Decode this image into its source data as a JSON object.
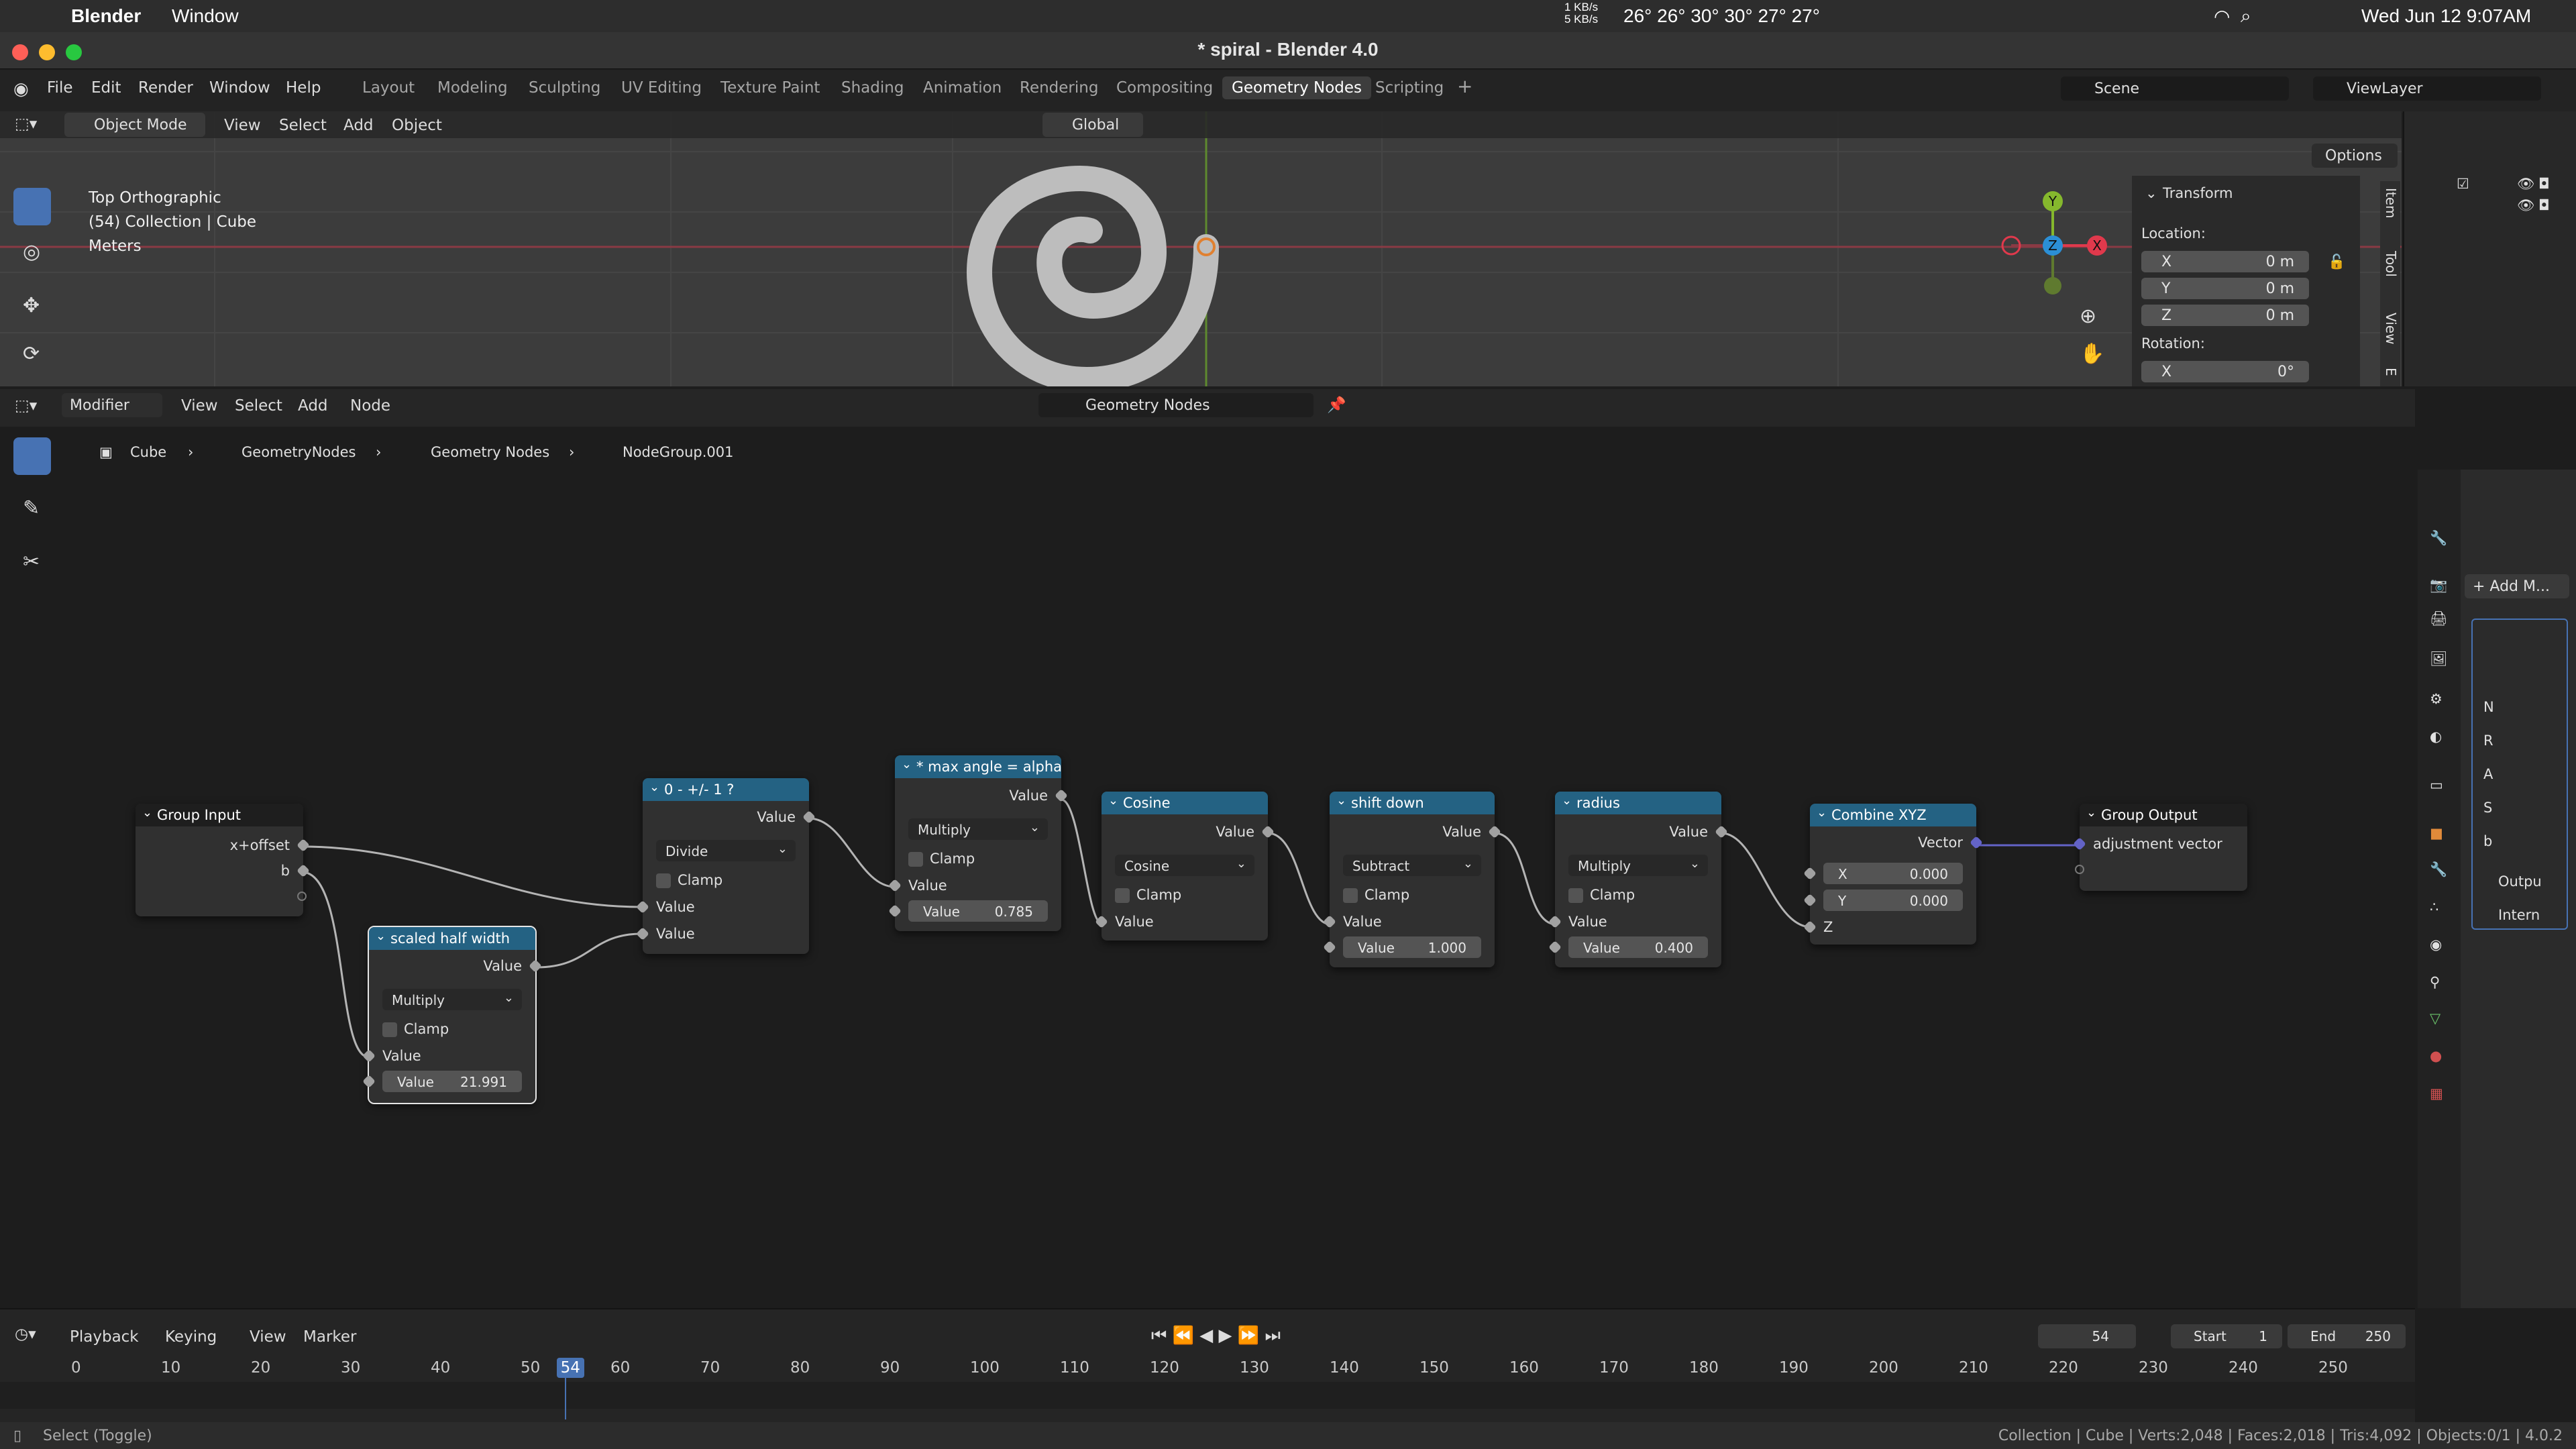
{
  "mac_menubar": {
    "app": "Blender",
    "menu": "Window",
    "net_up": "1 KB/s",
    "net_down": "5 KB/s",
    "temps": "26° 26° 30° 30° 27° 27°",
    "datetime": "Wed Jun 12  9:07AM"
  },
  "window": {
    "title": "* spiral - Blender 4.0"
  },
  "topbar": {
    "menus": [
      "File",
      "Edit",
      "Render",
      "Window",
      "Help"
    ],
    "workspaces": [
      "Layout",
      "Modeling",
      "Sculpting",
      "UV Editing",
      "Texture Paint",
      "Shading",
      "Animation",
      "Rendering",
      "Compositing",
      "Geometry Nodes",
      "Scripting"
    ],
    "active_workspace": "Geometry Nodes",
    "scene": "Scene",
    "view_layer": "ViewLayer"
  },
  "viewport": {
    "mode": "Object Mode",
    "menus": [
      "View",
      "Select",
      "Add",
      "Object"
    ],
    "orientation": "Global",
    "options": "Options",
    "overlay_lines": [
      "Top Orthographic",
      "(54) Collection | Cube",
      "Meters"
    ],
    "gizmo_axes": [
      "Y",
      "Z",
      "X"
    ],
    "side_tabs": [
      "Item",
      "Tool",
      "View",
      "E"
    ],
    "transform": {
      "title": "Transform",
      "location_label": "Location:",
      "loc": [
        {
          "axis": "X",
          "value": "0 m"
        },
        {
          "axis": "Y",
          "value": "0 m"
        },
        {
          "axis": "Z",
          "value": "0 m"
        }
      ],
      "rotation_label": "Rotation:",
      "rot": [
        {
          "axis": "X",
          "value": "0°"
        }
      ]
    }
  },
  "node_editor": {
    "editor_type": "Modifier",
    "menus": [
      "View",
      "Select",
      "Add",
      "Node"
    ],
    "tree_name": "Geometry Nodes",
    "breadcrumbs": [
      "Cube",
      "GeometryNodes",
      "Geometry Nodes",
      "NodeGroup.001"
    ],
    "group_input": {
      "title": "Group Input",
      "outputs": [
        "x+offset",
        "b"
      ]
    },
    "node_divide": {
      "title": "0 - +/- 1 ?",
      "output": "Value",
      "op": "Divide",
      "clamp": "Clamp",
      "inputs": [
        "Value",
        "Value"
      ]
    },
    "node_scaled": {
      "title": "scaled half width",
      "output": "Value",
      "op": "Multiply",
      "clamp": "Clamp",
      "input": "Value",
      "field_label": "Value",
      "field_value": "21.991"
    },
    "node_maxangle": {
      "title": "* max angle = alpha",
      "output": "Value",
      "op": "Multiply",
      "clamp": "Clamp",
      "input": "Value",
      "field_label": "Value",
      "field_value": "0.785"
    },
    "node_cosine": {
      "title": "Cosine",
      "output": "Value",
      "op": "Cosine",
      "clamp": "Clamp",
      "input": "Value"
    },
    "node_shift": {
      "title": "shift down",
      "output": "Value",
      "op": "Subtract",
      "clamp": "Clamp",
      "input": "Value",
      "field_label": "Value",
      "field_value": "1.000"
    },
    "node_radius": {
      "title": "radius",
      "output": "Value",
      "op": "Multiply",
      "clamp": "Clamp",
      "input": "Value",
      "field_label": "Value",
      "field_value": "0.400"
    },
    "node_combine": {
      "title": "Combine XYZ",
      "output": "Vector",
      "x_label": "X",
      "x_value": "0.000",
      "y_label": "Y",
      "y_value": "0.000",
      "z_label": "Z"
    },
    "group_output": {
      "title": "Group Output",
      "input": "adjustment vector"
    }
  },
  "properties": {
    "add_modifier": "+ Add M...",
    "letters": [
      "N",
      "R",
      "A",
      "S",
      "b"
    ],
    "sections": [
      "Outpu",
      "Intern"
    ]
  },
  "timeline": {
    "menus": [
      "Playback",
      "Keying",
      "View",
      "Marker"
    ],
    "current_frame": "54",
    "start_label": "Start",
    "start": "1",
    "end_label": "End",
    "end": "250",
    "ticks": [
      "0",
      "10",
      "20",
      "30",
      "40",
      "50",
      "54",
      "60",
      "70",
      "80",
      "90",
      "100",
      "110",
      "120",
      "130",
      "140",
      "150",
      "160",
      "170",
      "180",
      "190",
      "200",
      "210",
      "220",
      "230",
      "240",
      "250"
    ]
  },
  "statusbar": {
    "left": "Select (Toggle)",
    "right": "Collection | Cube | Verts:2,048 | Faces:2,018 | Tris:4,092 | Objects:0/1 | 4.0.2"
  },
  "colors": {
    "node_header_blue": "#246283",
    "accent": "#4772b3",
    "axis_x": "#e0394c",
    "axis_y": "#85b82d",
    "axis_z": "#2b8fd6"
  }
}
